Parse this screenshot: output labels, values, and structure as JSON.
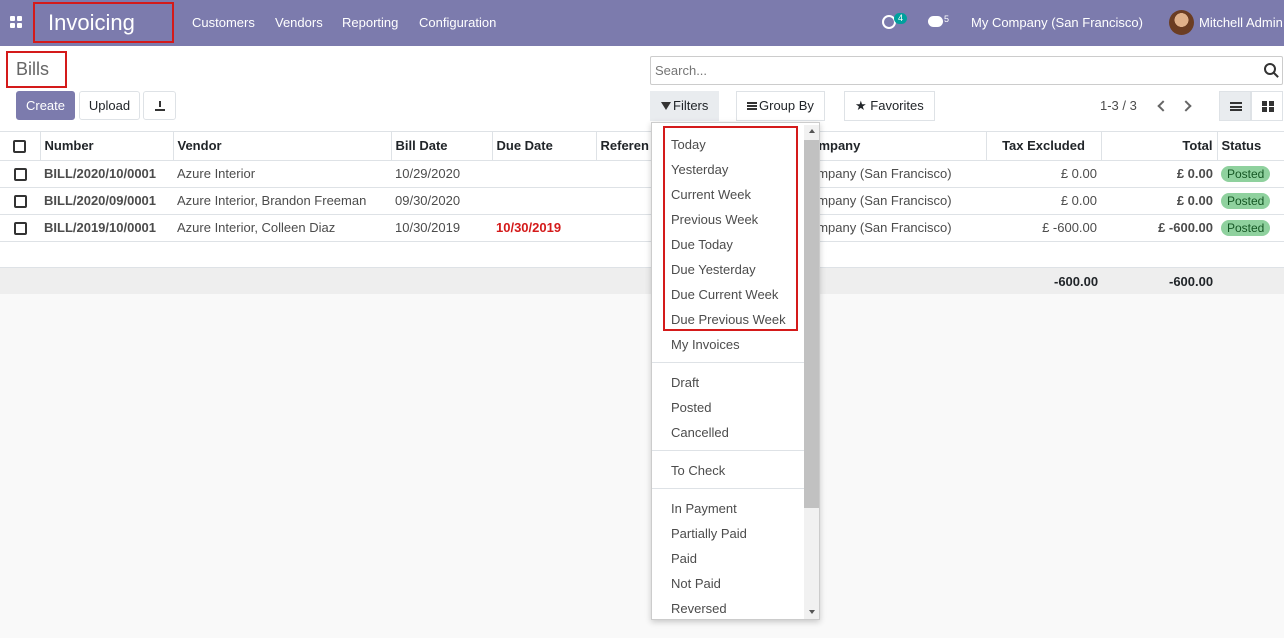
{
  "navbar": {
    "app_name": "Invoicing",
    "menus": [
      "Customers",
      "Vendors",
      "Reporting",
      "Configuration"
    ],
    "activity_count": "4",
    "message_count": "5",
    "company": "My Company (San Francisco)",
    "user": "Mitchell Admin"
  },
  "control_panel": {
    "title": "Bills",
    "create_label": "Create",
    "upload_label": "Upload",
    "search_placeholder": "Search...",
    "filters_label": "Filters",
    "group_by_label": "Group By",
    "favorites_label": "Favorites",
    "pager": "1-3 / 3"
  },
  "table": {
    "headers": [
      "Number",
      "Vendor",
      "Bill Date",
      "Due Date",
      "Referen",
      "ompany",
      "Tax Excluded",
      "Total",
      "Status"
    ],
    "rows": [
      {
        "number": "BILL/2020/10/0001",
        "vendor": "Azure Interior",
        "bill_date": "10/29/2020",
        "due_date": "",
        "company": "ompany (San Francisco)",
        "tax_excluded": "£ 0.00",
        "total": "£ 0.00",
        "status": "Posted"
      },
      {
        "number": "BILL/2020/09/0001",
        "vendor": "Azure Interior, Brandon Freeman",
        "bill_date": "09/30/2020",
        "due_date": "",
        "company": "ompany (San Francisco)",
        "tax_excluded": "£ 0.00",
        "total": "£ 0.00",
        "status": "Posted"
      },
      {
        "number": "BILL/2019/10/0001",
        "vendor": "Azure Interior, Colleen Diaz",
        "bill_date": "10/30/2019",
        "due_date": "10/30/2019",
        "company": "ompany (San Francisco)",
        "tax_excluded": "£ -600.00",
        "total": "£ -600.00",
        "status": "Posted"
      }
    ],
    "totals": {
      "tax_excluded": "-600.00",
      "total": "-600.00"
    }
  },
  "filters_dropdown": {
    "group1": [
      "Today",
      "Yesterday",
      "Current Week",
      "Previous Week",
      "Due Today",
      "Due Yesterday",
      "Due Current Week",
      "Due Previous Week",
      "My Invoices"
    ],
    "group2": [
      "Draft",
      "Posted",
      "Cancelled"
    ],
    "group3": [
      "To Check"
    ],
    "group4": [
      "In Payment",
      "Partially Paid",
      "Paid",
      "Not Paid",
      "Reversed"
    ]
  },
  "colors": {
    "navbar": "#7c7bad",
    "primary": "#7c7bad",
    "highlight_border": "#d41a1a",
    "danger_text": "#d41a1a",
    "status_badge": "#8fd19e"
  }
}
